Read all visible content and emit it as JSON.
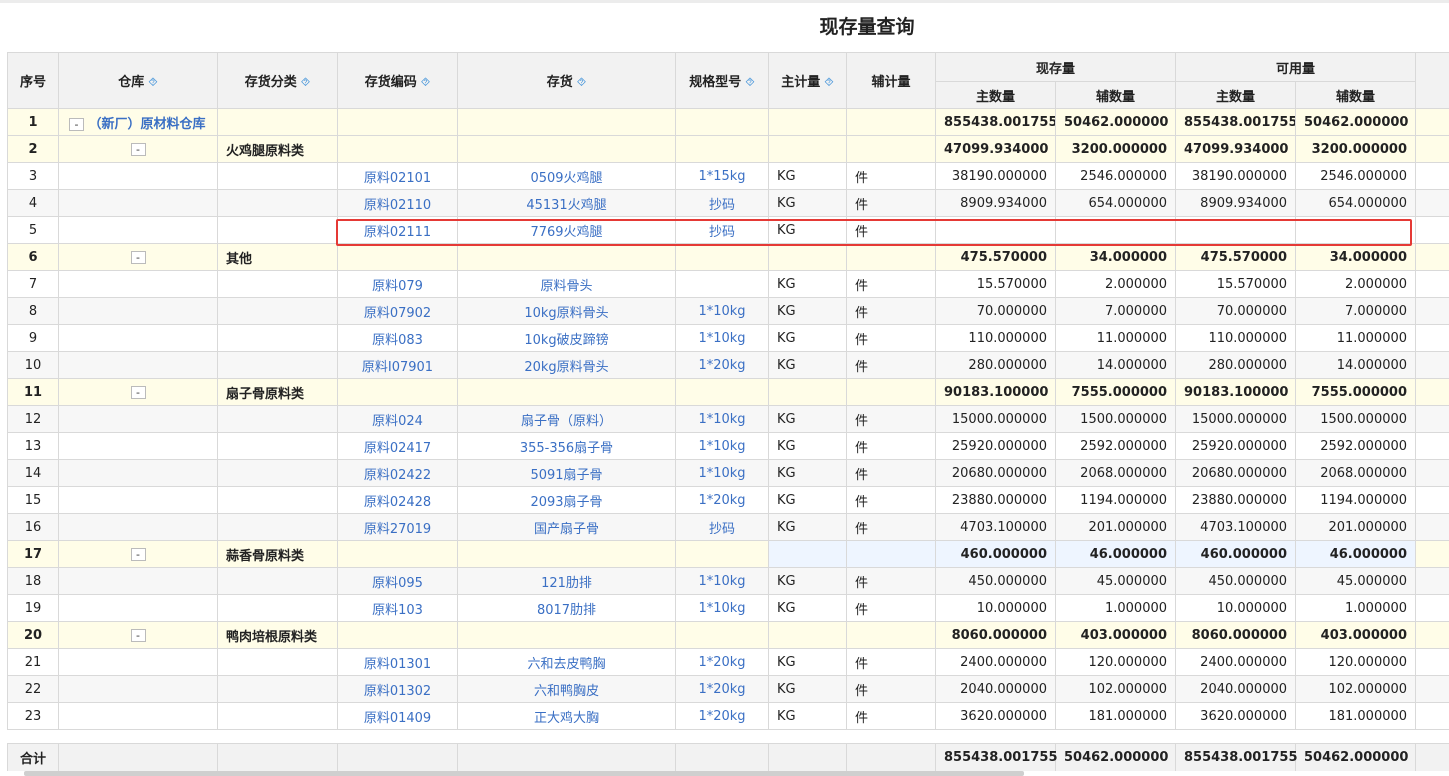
{
  "title": "现存量查询",
  "headers": {
    "seq": "序号",
    "warehouse": "仓库",
    "category": "存货分类",
    "code": "存货编码",
    "item": "存货",
    "spec": "规格型号",
    "main_unit": "主计量",
    "aux_unit": "辅计量",
    "current_qty": "现存量",
    "available_qty": "可用量",
    "main_count": "主数量",
    "aux_count": "辅数量"
  },
  "pin_glyph": "⯑",
  "rows": [
    {
      "seq": "1",
      "type": "warehouse",
      "toggle": "-",
      "warehouse": "（新厂）原材料仓库",
      "category": "",
      "code": "",
      "item": "",
      "spec": "",
      "main_unit": "",
      "aux_unit": "",
      "cur_main": "855438.001755",
      "cur_aux": "50462.000000",
      "av_main": "855438.001755",
      "av_aux": "50462.000000"
    },
    {
      "seq": "2",
      "type": "group",
      "toggle": "-",
      "warehouse": "",
      "category": "火鸡腿原料类",
      "code": "",
      "item": "",
      "spec": "",
      "main_unit": "",
      "aux_unit": "",
      "cur_main": "47099.934000",
      "cur_aux": "3200.000000",
      "av_main": "47099.934000",
      "av_aux": "3200.000000"
    },
    {
      "seq": "3",
      "type": "item",
      "warehouse": "",
      "category": "",
      "code": "原料02101",
      "item": "0509火鸡腿",
      "spec": "1*15kg",
      "main_unit": "KG",
      "aux_unit": "件",
      "cur_main": "38190.000000",
      "cur_aux": "2546.000000",
      "av_main": "38190.000000",
      "av_aux": "2546.000000"
    },
    {
      "seq": "4",
      "type": "item",
      "warehouse": "",
      "category": "",
      "code": "原料02110",
      "item": "45131火鸡腿",
      "spec": "抄码",
      "main_unit": "KG",
      "aux_unit": "件",
      "cur_main": "8909.934000",
      "cur_aux": "654.000000",
      "av_main": "8909.934000",
      "av_aux": "654.000000"
    },
    {
      "seq": "5",
      "type": "item",
      "warehouse": "",
      "category": "",
      "code": "原料02111",
      "item": "7769火鸡腿",
      "spec": "抄码",
      "main_unit": "KG",
      "aux_unit": "件",
      "cur_main": "",
      "cur_aux": "",
      "av_main": "",
      "av_aux": ""
    },
    {
      "seq": "6",
      "type": "group",
      "toggle": "-",
      "warehouse": "",
      "category": "其他",
      "code": "",
      "item": "",
      "spec": "",
      "main_unit": "",
      "aux_unit": "",
      "cur_main": "475.570000",
      "cur_aux": "34.000000",
      "av_main": "475.570000",
      "av_aux": "34.000000"
    },
    {
      "seq": "7",
      "type": "item",
      "warehouse": "",
      "category": "",
      "code": "原料079",
      "item": "原料骨头",
      "spec": "",
      "main_unit": "KG",
      "aux_unit": "件",
      "cur_main": "15.570000",
      "cur_aux": "2.000000",
      "av_main": "15.570000",
      "av_aux": "2.000000"
    },
    {
      "seq": "8",
      "type": "item",
      "warehouse": "",
      "category": "",
      "code": "原料07902",
      "item": "10kg原料骨头",
      "spec": "1*10kg",
      "main_unit": "KG",
      "aux_unit": "件",
      "cur_main": "70.000000",
      "cur_aux": "7.000000",
      "av_main": "70.000000",
      "av_aux": "7.000000"
    },
    {
      "seq": "9",
      "type": "item",
      "warehouse": "",
      "category": "",
      "code": "原料083",
      "item": "10kg破皮蹄镑",
      "spec": "1*10kg",
      "main_unit": "KG",
      "aux_unit": "件",
      "cur_main": "110.000000",
      "cur_aux": "11.000000",
      "av_main": "110.000000",
      "av_aux": "11.000000"
    },
    {
      "seq": "10",
      "type": "item",
      "warehouse": "",
      "category": "",
      "code": "原料I07901",
      "item": "20kg原料骨头",
      "spec": "1*20kg",
      "main_unit": "KG",
      "aux_unit": "件",
      "cur_main": "280.000000",
      "cur_aux": "14.000000",
      "av_main": "280.000000",
      "av_aux": "14.000000"
    },
    {
      "seq": "11",
      "type": "group",
      "toggle": "-",
      "warehouse": "",
      "category": "扇子骨原料类",
      "code": "",
      "item": "",
      "spec": "",
      "main_unit": "",
      "aux_unit": "",
      "cur_main": "90183.100000",
      "cur_aux": "7555.000000",
      "av_main": "90183.100000",
      "av_aux": "7555.000000"
    },
    {
      "seq": "12",
      "type": "item",
      "warehouse": "",
      "category": "",
      "code": "原料024",
      "item": "扇子骨（原料）",
      "spec": "1*10kg",
      "main_unit": "KG",
      "aux_unit": "件",
      "cur_main": "15000.000000",
      "cur_aux": "1500.000000",
      "av_main": "15000.000000",
      "av_aux": "1500.000000"
    },
    {
      "seq": "13",
      "type": "item",
      "warehouse": "",
      "category": "",
      "code": "原料02417",
      "item": "355-356扇子骨",
      "spec": "1*10kg",
      "main_unit": "KG",
      "aux_unit": "件",
      "cur_main": "25920.000000",
      "cur_aux": "2592.000000",
      "av_main": "25920.000000",
      "av_aux": "2592.000000"
    },
    {
      "seq": "14",
      "type": "item",
      "warehouse": "",
      "category": "",
      "code": "原料02422",
      "item": "5091扇子骨",
      "spec": "1*10kg",
      "main_unit": "KG",
      "aux_unit": "件",
      "cur_main": "20680.000000",
      "cur_aux": "2068.000000",
      "av_main": "20680.000000",
      "av_aux": "2068.000000"
    },
    {
      "seq": "15",
      "type": "item",
      "warehouse": "",
      "category": "",
      "code": "原料02428",
      "item": "2093扇子骨",
      "spec": "1*20kg",
      "main_unit": "KG",
      "aux_unit": "件",
      "cur_main": "23880.000000",
      "cur_aux": "1194.000000",
      "av_main": "23880.000000",
      "av_aux": "1194.000000"
    },
    {
      "seq": "16",
      "type": "item",
      "warehouse": "",
      "category": "",
      "code": "原料27019",
      "item": "国产扇子骨",
      "spec": "抄码",
      "main_unit": "KG",
      "aux_unit": "件",
      "cur_main": "4703.100000",
      "cur_aux": "201.000000",
      "av_main": "4703.100000",
      "av_aux": "201.000000"
    },
    {
      "seq": "17",
      "type": "group",
      "toggle": "-",
      "warehouse": "",
      "category": "蒜香骨原料类",
      "code": "",
      "item": "",
      "spec": "",
      "main_unit": "",
      "aux_unit": "",
      "cur_main": "460.000000",
      "cur_aux": "46.000000",
      "av_main": "460.000000",
      "av_aux": "46.000000"
    },
    {
      "seq": "18",
      "type": "item",
      "warehouse": "",
      "category": "",
      "code": "原料095",
      "item": "121肋排",
      "spec": "1*10kg",
      "main_unit": "KG",
      "aux_unit": "件",
      "cur_main": "450.000000",
      "cur_aux": "45.000000",
      "av_main": "450.000000",
      "av_aux": "45.000000"
    },
    {
      "seq": "19",
      "type": "item",
      "warehouse": "",
      "category": "",
      "code": "原料103",
      "item": "8017肋排",
      "spec": "1*10kg",
      "main_unit": "KG",
      "aux_unit": "件",
      "cur_main": "10.000000",
      "cur_aux": "1.000000",
      "av_main": "10.000000",
      "av_aux": "1.000000"
    },
    {
      "seq": "20",
      "type": "group",
      "toggle": "-",
      "warehouse": "",
      "category": "鸭肉培根原料类",
      "code": "",
      "item": "",
      "spec": "",
      "main_unit": "",
      "aux_unit": "",
      "cur_main": "8060.000000",
      "cur_aux": "403.000000",
      "av_main": "8060.000000",
      "av_aux": "403.000000"
    },
    {
      "seq": "21",
      "type": "item",
      "warehouse": "",
      "category": "",
      "code": "原料01301",
      "item": "六和去皮鸭胸",
      "spec": "1*20kg",
      "main_unit": "KG",
      "aux_unit": "件",
      "cur_main": "2400.000000",
      "cur_aux": "120.000000",
      "av_main": "2400.000000",
      "av_aux": "120.000000"
    },
    {
      "seq": "22",
      "type": "item",
      "warehouse": "",
      "category": "",
      "code": "原料01302",
      "item": "六和鸭胸皮",
      "spec": "1*20kg",
      "main_unit": "KG",
      "aux_unit": "件",
      "cur_main": "2040.000000",
      "cur_aux": "102.000000",
      "av_main": "2040.000000",
      "av_aux": "102.000000"
    },
    {
      "seq": "23",
      "type": "item",
      "warehouse": "",
      "category": "",
      "code": "原料01409",
      "item": "正大鸡大胸",
      "spec": "1*20kg",
      "main_unit": "KG",
      "aux_unit": "件",
      "cur_main": "3620.000000",
      "cur_aux": "181.000000",
      "av_main": "3620.000000",
      "av_aux": "181.000000"
    }
  ],
  "footer": {
    "label": "合计",
    "cur_main": "855438.001755",
    "cur_aux": "50462.000000",
    "av_main": "855438.001755",
    "av_aux": "50462.000000"
  }
}
